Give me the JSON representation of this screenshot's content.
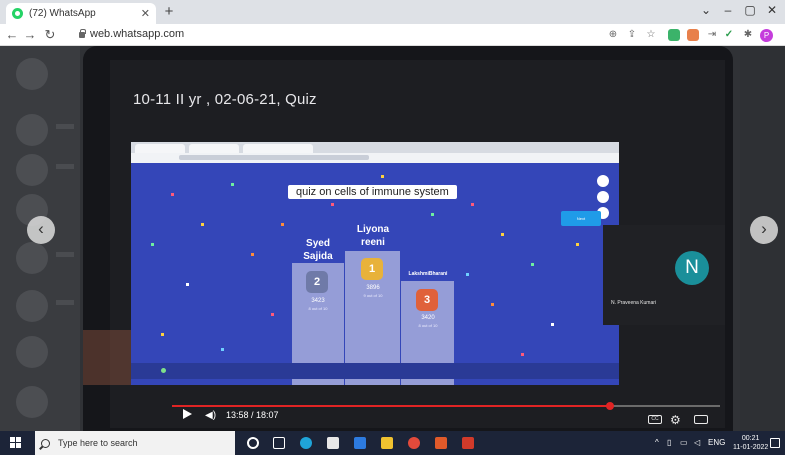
{
  "browser": {
    "tab_title": "(72) WhatsApp",
    "url": "web.whatsapp.com"
  },
  "photo": {
    "meeting_title": "10-11 II yr , 02-06-21, Quiz",
    "quiz_title": "quiz on cells of immune system",
    "leaderboard": [
      {
        "name": "Syed\nSajida",
        "rank": "2",
        "score": "3423",
        "subtitle": "8 out of 10"
      },
      {
        "name": "Liyona\nreeni",
        "rank": "1",
        "score": "3896",
        "subtitle": "9 out of 10"
      },
      {
        "name": "LakshmiBharani",
        "rank": "3",
        "score": "3420",
        "subtitle": "8 out of 10"
      }
    ],
    "participant": {
      "initial": "N",
      "name": "N. Praveena Kumari"
    },
    "player_time": "13:58 / 18:07",
    "player_progress": 0.8
  },
  "taskbar": {
    "search_placeholder": "Type here to search",
    "language": "ENG",
    "clock_time": "00:21",
    "clock_date": "11-01-2022"
  }
}
